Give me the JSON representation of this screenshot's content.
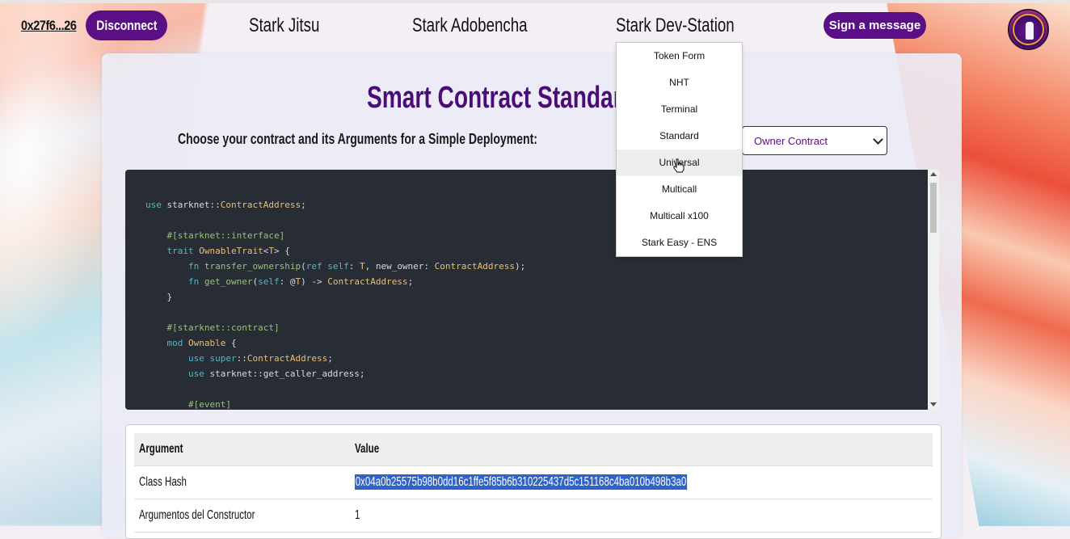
{
  "header": {
    "wallet_address": "0x27f6...26",
    "disconnect_label": "Disconnect",
    "nav": [
      "Stark Jitsu",
      "Stark Adobencha",
      "Stark Dev-Station"
    ],
    "sign_label": "Sign a message",
    "logo_icon": "stark-easy-logo"
  },
  "dev_menu": {
    "items": [
      "Token Form",
      "NHT",
      "Terminal",
      "Standard",
      "Universal",
      "Multicall",
      "Multicall x100",
      "Stark Easy - ENS"
    ],
    "hovered_index": 4
  },
  "main": {
    "title": "Smart Contract Standard",
    "choose_label": "Choose your contract and its Arguments for a Simple Deployment:",
    "contract_select_value": "Owner Contract"
  },
  "code": [
    "use starknet::ContractAddress;",
    "",
    "    #[starknet::interface]",
    "    trait OwnableTrait<T> {",
    "        fn transfer_ownership(ref self: T, new_owner: ContractAddress);",
    "        fn get_owner(self: @T) -> ContractAddress;",
    "    }",
    "",
    "    #[starknet::contract]",
    "    mod Ownable {",
    "        use super::ContractAddress;",
    "        use starknet::get_caller_address;",
    "",
    "        #[event]"
  ],
  "table": {
    "headers": [
      "Argument",
      "Value"
    ],
    "rows": [
      [
        "Class Hash",
        "0x04a0b25575b98b0dd16c1ffe5f85b6b310225437d5c151168c4ba010b498b3a0"
      ],
      [
        "Argumentos del Constructor",
        "1"
      ]
    ]
  },
  "colors": {
    "brand_purple": "#5b0f86",
    "title_purple": "#4a0c77",
    "code_bg": "#282c34",
    "selection": "#2f63c8"
  }
}
